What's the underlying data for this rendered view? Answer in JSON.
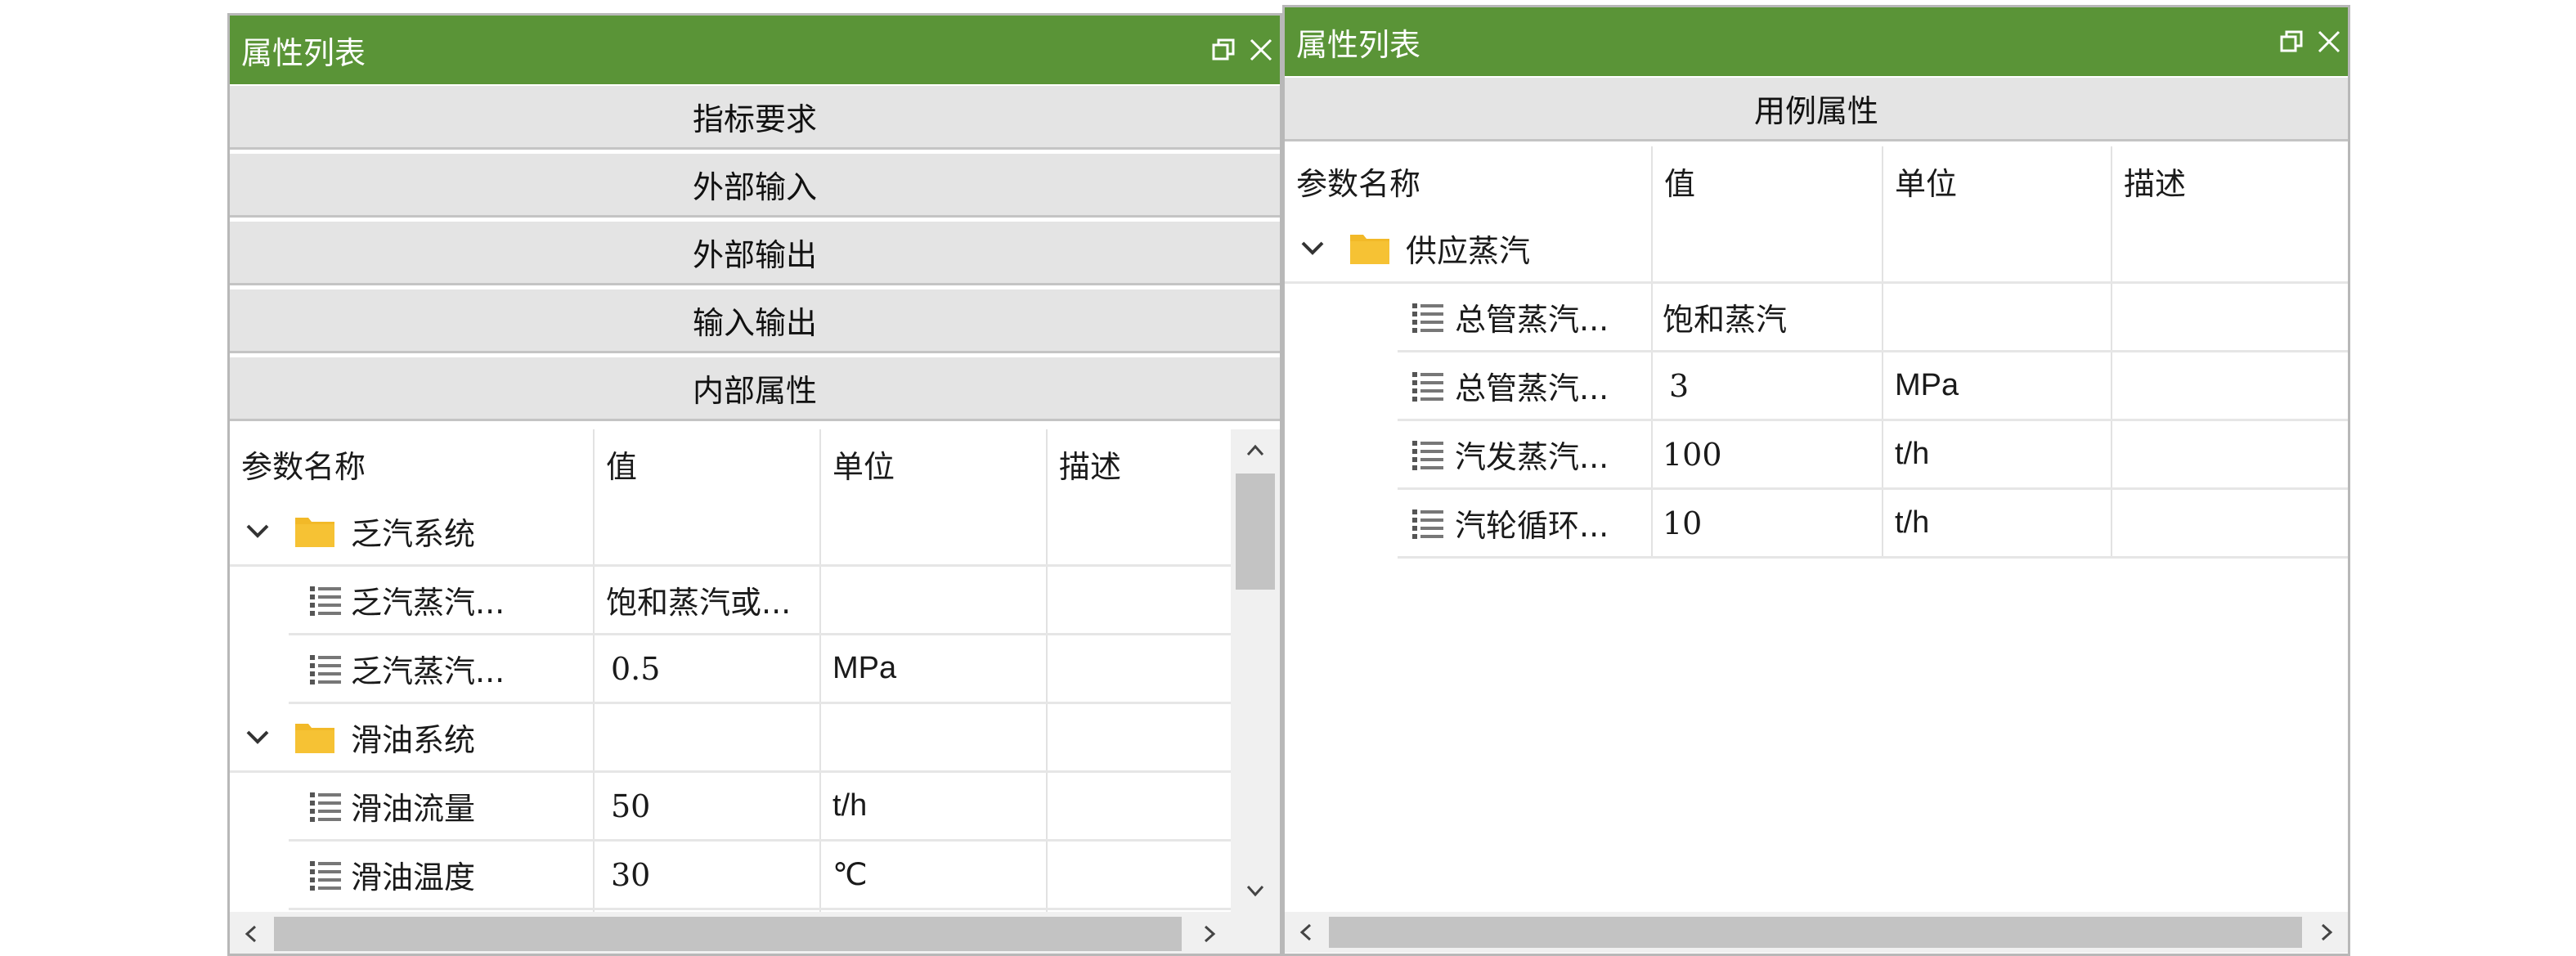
{
  "left_panel": {
    "title": "属性列表",
    "sections": [
      "指标要求",
      "外部输入",
      "外部输出",
      "输入输出",
      "内部属性"
    ],
    "columns": [
      "参数名称",
      "值",
      "单位",
      "描述"
    ],
    "groups": [
      {
        "name": "乏汽系统",
        "rows": [
          {
            "name": "乏汽蒸汽...",
            "value": "饱和蒸汽或...",
            "unit": "",
            "desc": ""
          },
          {
            "name": "乏汽蒸汽...",
            "value": "0.5",
            "unit": "MPa",
            "desc": ""
          }
        ]
      },
      {
        "name": "滑油系统",
        "rows": [
          {
            "name": "滑油流量",
            "value": "50",
            "unit": "t/h",
            "desc": ""
          },
          {
            "name": "滑油温度",
            "value": "30",
            "unit": "℃",
            "desc": ""
          }
        ]
      }
    ]
  },
  "right_panel": {
    "title": "属性列表",
    "section": "用例属性",
    "columns": [
      "参数名称",
      "值",
      "单位",
      "描述"
    ],
    "groups": [
      {
        "name": "供应蒸汽",
        "rows": [
          {
            "name": "总管蒸汽...",
            "value": "饱和蒸汽",
            "unit": "",
            "desc": ""
          },
          {
            "name": "总管蒸汽...",
            "value": "3",
            "unit": "MPa",
            "desc": ""
          },
          {
            "name": "汽发蒸汽...",
            "value": "100",
            "unit": "t/h",
            "desc": ""
          },
          {
            "name": "汽轮循环...",
            "value": "10",
            "unit": "t/h",
            "desc": ""
          }
        ]
      }
    ]
  },
  "icons": {
    "restore": "restore-window-icon",
    "close": "close-icon",
    "expand": "chevron-down-icon",
    "folder": "folder-icon",
    "property": "list-icon"
  },
  "colors": {
    "title_bar": "#5a9437",
    "section_bg": "#e4e4e4",
    "folder": "#f2b928"
  }
}
